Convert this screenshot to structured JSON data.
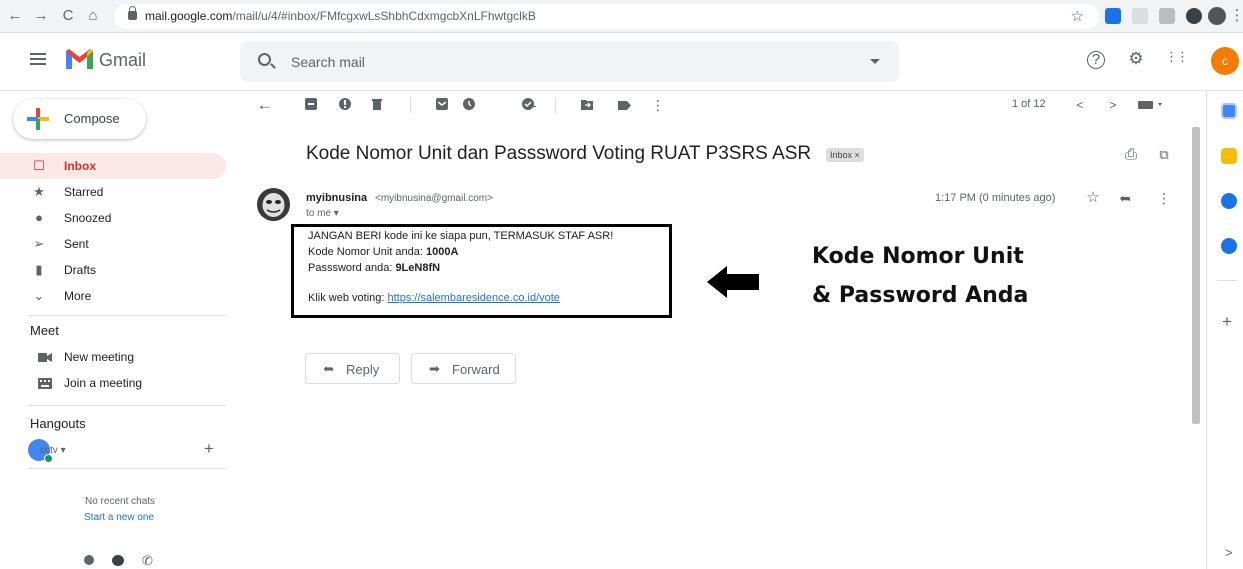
{
  "browser": {
    "url_host": "mail.google.com",
    "url_path": "/mail/u/4/#inbox/FMfcgxwLsShbhCdxmgcbXnLFhwtgclkB",
    "back_glyph": "←",
    "forward_glyph": "→",
    "reload_glyph": "C",
    "home_glyph": "⌂",
    "star_glyph": "☆",
    "menu_glyph": "⋮"
  },
  "header": {
    "app_name": "Gmail",
    "search_placeholder": "Search mail",
    "avatar_letter": "c",
    "help_glyph": "?",
    "settings_glyph": "⚙",
    "apps_glyph": "⋮⋮"
  },
  "sidebar": {
    "compose_label": "Compose",
    "items": [
      {
        "label": "Inbox",
        "icon": "inbox-icon",
        "glyph": "☐"
      },
      {
        "label": "Starred",
        "icon": "star-icon",
        "glyph": "★"
      },
      {
        "label": "Snoozed",
        "icon": "clock-icon",
        "glyph": "●"
      },
      {
        "label": "Sent",
        "icon": "send-icon",
        "glyph": "➢"
      },
      {
        "label": "Drafts",
        "icon": "draft-icon",
        "glyph": "▮"
      },
      {
        "label": "More",
        "icon": "chevron-down-icon",
        "glyph": "⌄"
      }
    ],
    "meet_title": "Meet",
    "meet_items": [
      {
        "label": "New meeting",
        "icon": "video-icon"
      },
      {
        "label": "Join a meeting",
        "icon": "keyboard-icon"
      }
    ],
    "hangouts_title": "Hangouts",
    "hangouts_user": "cctv",
    "hangouts_user_caret": "▾",
    "hangouts_add": "+",
    "no_chats": "No recent chats",
    "start_new": "Start a new one"
  },
  "toolbar": {
    "pager": "1 of 12",
    "back_glyph": "←",
    "prev_glyph": "<",
    "next_glyph": ">",
    "more_glyph": "⋮"
  },
  "message": {
    "subject": "Kode Nomor Unit dan Passsword Voting RUAT P3SRS ASR",
    "label_badge": "Inbox ×",
    "sender_name": "myibnusina",
    "sender_email": "<myibnusina@gmail.com>",
    "to": "to me ▾",
    "time": "1:17 PM (0 minutes ago)",
    "star_glyph": "☆",
    "reply_glyph": "➦",
    "more_glyph": "⋮",
    "print_glyph": "⎙",
    "popout_glyph": "⧉",
    "body": {
      "line1": "JANGAN BERI kode ini ke siapa pun, TERMASUK STAF ASR!",
      "line2_prefix": "Kode Nomor Unit anda: ",
      "line2_value": "1000A",
      "line3_prefix": "Passsword anda: ",
      "line3_value": "9LeN8fN",
      "line4_prefix": "Klik web voting: ",
      "line4_link": "https://salembaresidence.co.id/vote"
    },
    "reply_label": "Reply",
    "forward_label": "Forward",
    "forward_glyph": "➡"
  },
  "annotation": {
    "line1": "Kode Nomor Unit",
    "line2": "& Password Anda"
  },
  "side_panel": {
    "add_glyph": "+",
    "expand_glyph": ">"
  },
  "colors": {
    "accent_red": "#d93025",
    "inbox_bg": "#fce8e6",
    "link": "#1a73e8",
    "avatar": "#f57c00"
  }
}
